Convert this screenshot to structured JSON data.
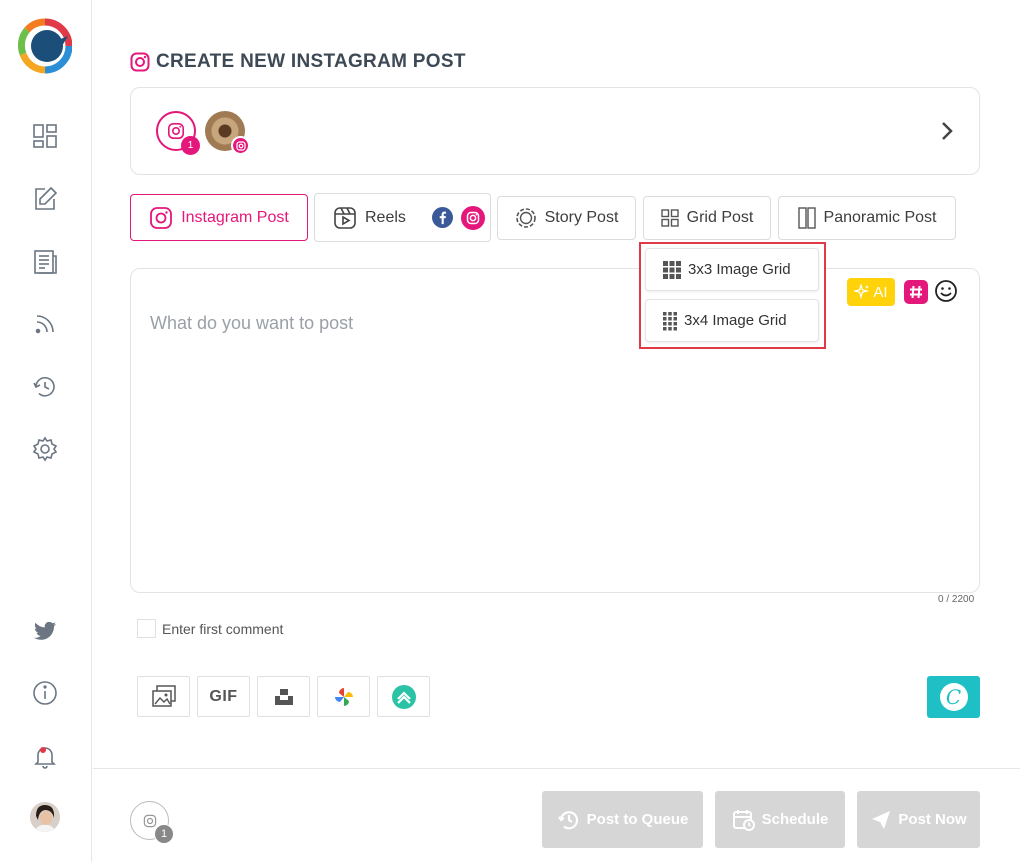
{
  "page": {
    "title": "CREATE NEW INSTAGRAM POST"
  },
  "accounts": {
    "selected_count": "1"
  },
  "tabs": [
    {
      "label": "Instagram Post",
      "icon": "instagram-icon",
      "active": true
    },
    {
      "label": "Reels",
      "icon": "reels-icon",
      "active": false
    },
    {
      "label": "Story Post",
      "icon": "story-icon",
      "active": false
    },
    {
      "label": "Grid Post",
      "icon": "grid-icon",
      "active": false
    },
    {
      "label": "Panoramic Post",
      "icon": "panoramic-icon",
      "active": false
    }
  ],
  "grid_menu": {
    "items": [
      {
        "label": "3x3 Image Grid",
        "icon": "grid-3x3-icon"
      },
      {
        "label": "3x4 Image Grid",
        "icon": "grid-3x4-icon"
      }
    ]
  },
  "composer": {
    "placeholder": "What do you want to post",
    "ai_label": "AI",
    "char_count": "0 / 2200"
  },
  "comment": {
    "label": "Enter first comment",
    "checked": false
  },
  "media_tools": {
    "gif_label": "GIF"
  },
  "footer": {
    "account_count": "1",
    "post_to_queue": "Post to Queue",
    "schedule": "Schedule",
    "post_now": "Post Now"
  },
  "colors": {
    "instagram_pink": "#e4177b",
    "ai_yellow": "#ffd20a",
    "canva_teal": "#1ec0c6",
    "highlight_red": "#e03a48",
    "disabled_gray": "#d6d6d6"
  }
}
